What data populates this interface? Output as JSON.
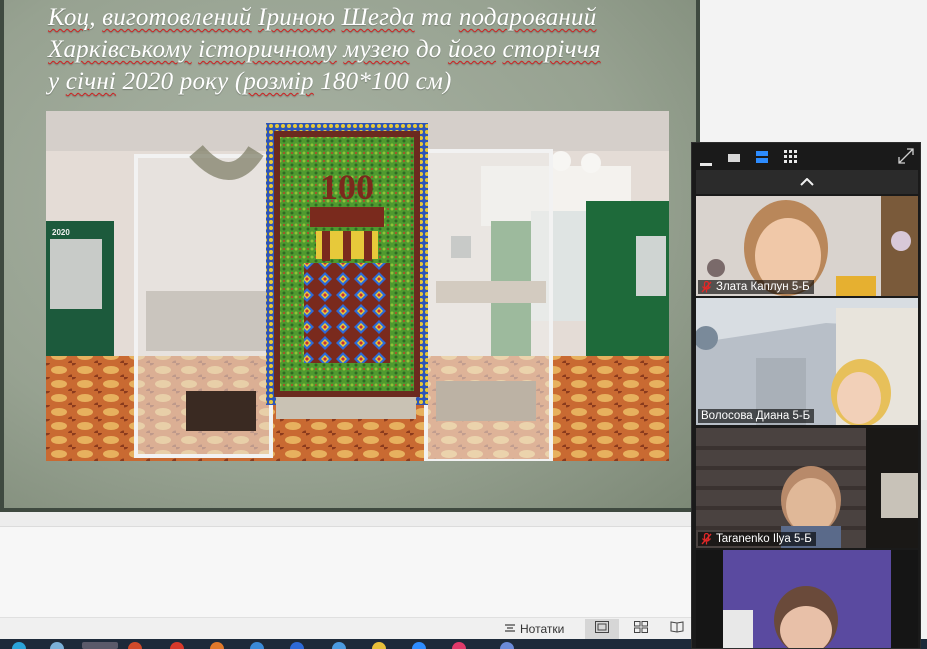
{
  "slide": {
    "caption_lines": [
      [
        "Коц",
        ", ",
        "виготовлений",
        " ",
        "Іриною",
        " ",
        "Шегда",
        " та ",
        "подарований"
      ],
      [
        "Харківському",
        " ",
        "історичному",
        " ",
        "музею",
        " до ",
        "його",
        " ",
        "сторіччя"
      ],
      [
        "у ",
        "січні",
        " 2020 року (",
        "розмір",
        " 180*100 см)"
      ]
    ],
    "caption_underlined": [
      [
        true,
        false,
        true,
        false,
        true,
        false,
        true,
        false,
        true
      ],
      [
        true,
        false,
        true,
        false,
        true,
        false,
        true,
        false,
        true
      ],
      [
        false,
        true,
        false,
        true,
        false
      ]
    ],
    "photo_carpet_text": "100",
    "photo_panel_text": "2020"
  },
  "statusbar": {
    "notes_label": "Нотатки",
    "views": [
      "normal-view",
      "slide-sorter-view",
      "reading-view"
    ]
  },
  "zoom": {
    "toolbar_icons": [
      "minimize-icon",
      "single-view-icon",
      "speaker-view-icon",
      "gallery-view-icon",
      "fullscreen-icon"
    ],
    "participants": [
      {
        "name": "Злата Каплун 5-Б",
        "muted": true
      },
      {
        "name": "Волосова Диана 5-Б",
        "muted": false
      },
      {
        "name": "Taranenko Ilya 5-Б",
        "muted": true
      },
      {
        "name": "",
        "muted": false
      }
    ]
  },
  "colors": {
    "slide_bg": "#97a291",
    "slide_border": "#3f4a40",
    "zoom_bg": "#1a1a1a",
    "accent_blue": "#2d8cff",
    "mute_red": "#e02828"
  }
}
